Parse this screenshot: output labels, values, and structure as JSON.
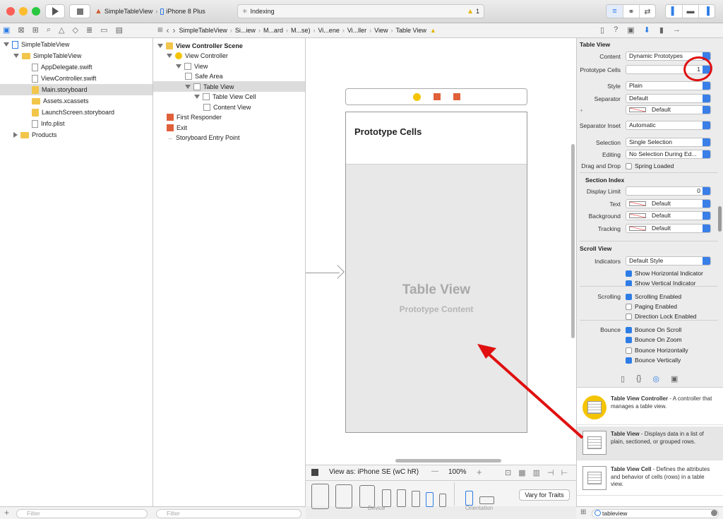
{
  "toolbar": {
    "scheme": "SimpleTableView",
    "device": "iPhone 8 Plus",
    "activity": "Indexing",
    "warnings": "1"
  },
  "breadcrumb": [
    "SimpleTableView",
    "Si...iew",
    "M...ard",
    "M...se)",
    "Vi...ene",
    "Vi...ller",
    "View",
    "Table View"
  ],
  "navigator": {
    "items": [
      {
        "label": "SimpleTableView",
        "indent": 0,
        "icon": "project",
        "disc": "open"
      },
      {
        "label": "SimpleTableView",
        "indent": 1,
        "icon": "folder",
        "disc": "open"
      },
      {
        "label": "AppDelegate.swift",
        "indent": 2,
        "icon": "swift"
      },
      {
        "label": "ViewController.swift",
        "indent": 2,
        "icon": "swift"
      },
      {
        "label": "Main.storyboard",
        "indent": 2,
        "icon": "storyboard",
        "selected": true
      },
      {
        "label": "Assets.xcassets",
        "indent": 2,
        "icon": "assets"
      },
      {
        "label": "LaunchScreen.storyboard",
        "indent": 2,
        "icon": "storyboard"
      },
      {
        "label": "Info.plist",
        "indent": 2,
        "icon": "plist"
      },
      {
        "label": "Products",
        "indent": 1,
        "icon": "folder",
        "disc": "closed"
      }
    ],
    "filter_placeholder": "Filter"
  },
  "outline": {
    "items": [
      {
        "label": "View Controller Scene",
        "indent": 0,
        "bold": true,
        "disc": "open"
      },
      {
        "label": "View Controller",
        "indent": 1,
        "disc": "open"
      },
      {
        "label": "View",
        "indent": 2,
        "disc": "open"
      },
      {
        "label": "Safe Area",
        "indent": 3
      },
      {
        "label": "Table View",
        "indent": 3,
        "disc": "open",
        "selected": true
      },
      {
        "label": "Table View Cell",
        "indent": 4,
        "disc": "open"
      },
      {
        "label": "Content View",
        "indent": 5
      },
      {
        "label": "First Responder",
        "indent": 1
      },
      {
        "label": "Exit",
        "indent": 1
      },
      {
        "label": "Storyboard Entry Point",
        "indent": 1
      }
    ],
    "filter_placeholder": "Filter"
  },
  "canvas": {
    "header": "Prototype Cells",
    "table_title": "Table View",
    "table_subtitle": "Prototype Content"
  },
  "canvasbar": {
    "view_as": "View as: iPhone SE (wC hR)",
    "zoom": "100%",
    "minus": "—",
    "plus": "+"
  },
  "devices": {
    "device_label": "Device",
    "orientation_label": "Orientation",
    "vary": "Vary for Traits"
  },
  "inspector": {
    "section1": "Table View",
    "rows": [
      {
        "label": "Content",
        "value": "Dynamic Prototypes",
        "kind": "pop"
      },
      {
        "label": "Prototype Cells",
        "value": "1",
        "kind": "field"
      },
      {
        "label": "Style",
        "value": "Plain",
        "kind": "pop"
      },
      {
        "label": "Separator",
        "value": "Default",
        "kind": "pop"
      },
      {
        "label": "+",
        "value": "Default",
        "kind": "color"
      },
      {
        "label": "Separator Inset",
        "value": "Automatic",
        "kind": "pop"
      },
      {
        "label": "Selection",
        "value": "Single Selection",
        "kind": "pop"
      },
      {
        "label": "Editing",
        "value": "No Selection During Ed...",
        "kind": "pop"
      },
      {
        "label": "Drag and Drop",
        "value": "Spring Loaded",
        "kind": "check",
        "on": false
      }
    ],
    "section_index": "Section Index",
    "rows2": [
      {
        "label": "Display Limit",
        "value": "0",
        "kind": "field"
      },
      {
        "label": "Text",
        "value": "Default",
        "kind": "color"
      },
      {
        "label": "Background",
        "value": "Default",
        "kind": "color"
      },
      {
        "label": "Tracking",
        "value": "Default",
        "kind": "color"
      }
    ],
    "section2": "Scroll View",
    "indicators_label": "Indicators",
    "indicators": "Default Style",
    "checks": [
      {
        "label": "",
        "value": "Show Horizontal Indicator",
        "on": true
      },
      {
        "label": "",
        "value": "Show Vertical Indicator",
        "on": true
      },
      {
        "label": "Scrolling",
        "value": "Scrolling Enabled",
        "on": true
      },
      {
        "label": "",
        "value": "Paging Enabled",
        "on": false
      },
      {
        "label": "",
        "value": "Direction Lock Enabled",
        "on": false
      },
      {
        "label": "Bounce",
        "value": "Bounce On Scroll",
        "on": true
      },
      {
        "label": "",
        "value": "Bounce On Zoom",
        "on": true
      },
      {
        "label": "",
        "value": "Bounce Horizontally",
        "on": false
      },
      {
        "label": "",
        "value": "Bounce Vertically",
        "on": true
      }
    ]
  },
  "library": {
    "items": [
      {
        "title": "Table View Controller",
        "desc": " - A controller that manages a table view."
      },
      {
        "title": "Table View",
        "desc": " - Displays data in a list of plain, sectioned, or grouped rows.",
        "selected": true
      },
      {
        "title": "Table View Cell",
        "desc": " - Defines the attributes and behavior of cells (rows) in a table view."
      }
    ],
    "search": "tableview"
  },
  "colors": {
    "accent": "#2e7de6",
    "annotation": "#e01010"
  }
}
